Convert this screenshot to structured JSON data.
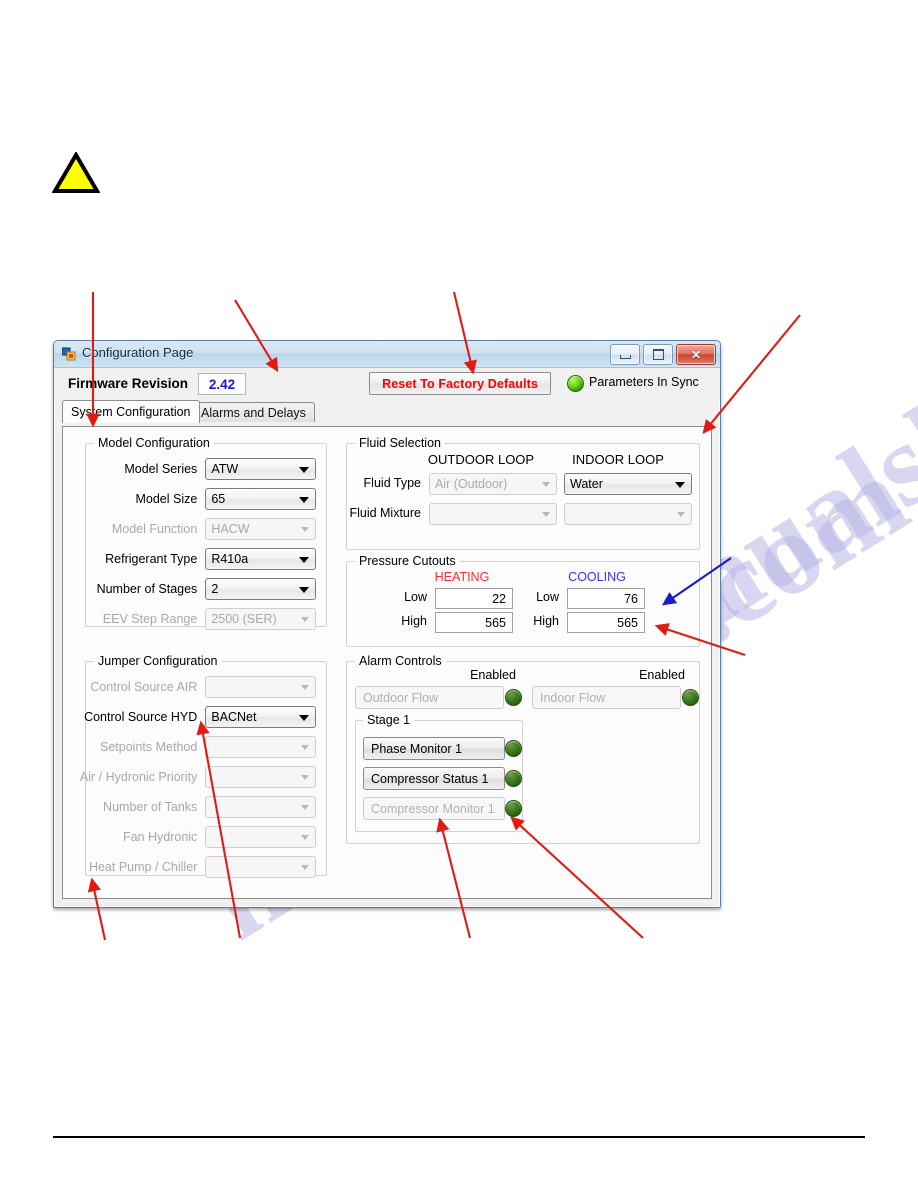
{
  "window": {
    "title": "Configuration Page",
    "icon": "app-window-icon",
    "buttons": {
      "minimize": "minimize-icon",
      "maximize": "maximize-icon",
      "close": "close-icon"
    }
  },
  "header": {
    "firmware_label": "Firmware Revision",
    "firmware_value": "2.42",
    "reset_button": "Reset To Factory Defaults",
    "sync_status": "Parameters In Sync",
    "sync_led_color": "#5fc10a",
    "firmware_value_color": "#1818cf",
    "reset_button_color": "#ff0000"
  },
  "tabs": [
    {
      "label": "System Configuration",
      "active": true
    },
    {
      "label": "Alarms and Delays",
      "active": false
    }
  ],
  "model_configuration": {
    "title": "Model Configuration",
    "fields": [
      {
        "label": "Model Series",
        "value": "ATW",
        "disabled": false
      },
      {
        "label": "Model Size",
        "value": "65",
        "disabled": false
      },
      {
        "label": "Model Function",
        "value": "HACW",
        "disabled": true
      },
      {
        "label": "Refrigerant Type",
        "value": "R410a",
        "disabled": false
      },
      {
        "label": "Number of Stages",
        "value": "2",
        "disabled": false
      },
      {
        "label": "EEV Step Range",
        "value": "2500 (SER)",
        "disabled": true
      }
    ]
  },
  "jumper_configuration": {
    "title": "Jumper Configuration",
    "fields": [
      {
        "label": "Control Source AIR",
        "value": "",
        "disabled": true
      },
      {
        "label": "Control Source HYD",
        "value": "BACNet",
        "disabled": false
      },
      {
        "label": "Setpoints Method",
        "value": "",
        "disabled": true
      },
      {
        "label": "Air / Hydronic Priority",
        "value": "",
        "disabled": true
      },
      {
        "label": "Number of Tanks",
        "value": "",
        "disabled": true
      },
      {
        "label": "Fan Hydronic",
        "value": "",
        "disabled": true
      },
      {
        "label": "Heat Pump / Chiller",
        "value": "",
        "disabled": true
      }
    ]
  },
  "fluid_selection": {
    "title": "Fluid Selection",
    "column_headers": [
      "OUTDOOR LOOP",
      "INDOOR LOOP"
    ],
    "rows": [
      {
        "label": "Fluid Type",
        "outdoor": {
          "value": "Air (Outdoor)",
          "disabled": true
        },
        "indoor": {
          "value": "Water",
          "disabled": false
        }
      },
      {
        "label": "Fluid Mixture",
        "outdoor": {
          "value": "",
          "disabled": true
        },
        "indoor": {
          "value": "",
          "disabled": true
        }
      }
    ]
  },
  "pressure_cutouts": {
    "title": "Pressure Cutouts",
    "heating_header": "HEATING",
    "cooling_header": "COOLING",
    "heating_color": "#ff2a2a",
    "cooling_color": "#3333ff",
    "heating": {
      "low_label": "Low",
      "low_value": "22",
      "high_label": "High",
      "high_value": "565"
    },
    "cooling": {
      "low_label": "Low",
      "low_value": "76",
      "high_label": "High",
      "high_value": "565"
    }
  },
  "alarm_controls": {
    "title": "Alarm Controls",
    "enabled_header_left": "Enabled",
    "enabled_header_right": "Enabled",
    "flow_row": [
      {
        "label": "Outdoor Flow",
        "disabled": true,
        "led": "on"
      },
      {
        "label": "Indoor Flow",
        "disabled": true,
        "led": "on"
      }
    ],
    "stage": {
      "title": "Stage 1",
      "items": [
        {
          "label": "Phase Monitor 1",
          "disabled": false,
          "led": "on"
        },
        {
          "label": "Compressor Status 1",
          "disabled": false,
          "led": "on"
        },
        {
          "label": "Compressor Monitor 1",
          "disabled": true,
          "led": "on"
        }
      ]
    }
  },
  "annotations": {
    "warning_icon": "warning-triangle-icon",
    "warning_fill": "#ffff00",
    "arrow_color_red": "#e01b16",
    "arrow_color_blue": "#1a1ad0",
    "watermark_text": "manualslib.com"
  }
}
